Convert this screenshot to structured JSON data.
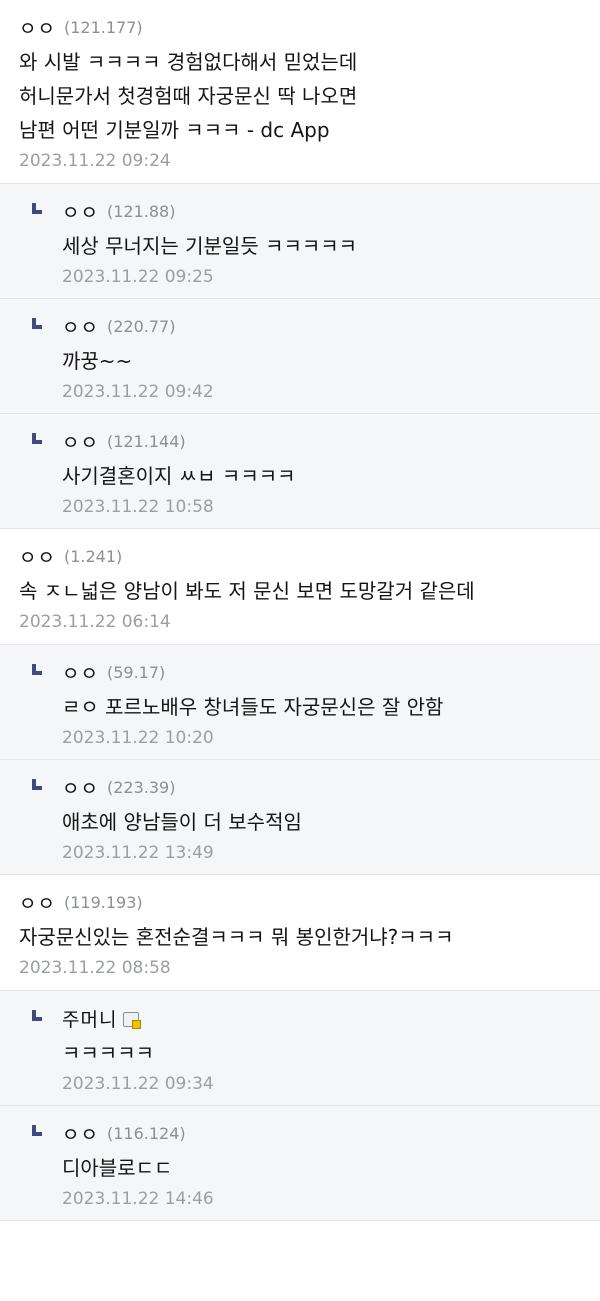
{
  "comments": [
    {
      "nick": "ㅇㅇ",
      "ip": "(121.177)",
      "lines": [
        "와 시발 ㅋㅋㅋㅋ 경험없다해서 믿었는데",
        "허니문가서 첫경험때 자궁문신 딱 나오면",
        "남편 어떤 기분일까 ㅋㅋㅋ - dc App"
      ],
      "date": "2023.11.22 09:24",
      "replies": [
        {
          "nick": "ㅇㅇ",
          "ip": "(121.88)",
          "text": "세상 무너지는 기분일듯 ㅋㅋㅋㅋㅋ",
          "date": "2023.11.22 09:25"
        },
        {
          "nick": "ㅇㅇ",
          "ip": "(220.77)",
          "text": "까꿍~~",
          "date": "2023.11.22 09:42"
        },
        {
          "nick": "ㅇㅇ",
          "ip": "(121.144)",
          "text": "사기결혼이지 ㅆㅂ ㅋㅋㅋㅋ",
          "date": "2023.11.22 10:58"
        }
      ]
    },
    {
      "nick": "ㅇㅇ",
      "ip": "(1.241)",
      "lines": [
        "속 ㅈㄴ넓은 양남이 봐도 저 문신 보면 도망갈거 같은데"
      ],
      "date": "2023.11.22 06:14",
      "replies": [
        {
          "nick": "ㅇㅇ",
          "ip": "(59.17)",
          "text": "ㄹㅇ 포르노배우 창녀들도 자궁문신은 잘 안함",
          "date": "2023.11.22 10:20"
        },
        {
          "nick": "ㅇㅇ",
          "ip": "(223.39)",
          "text": "애초에 양남들이 더 보수적임",
          "date": "2023.11.22 13:49"
        }
      ]
    },
    {
      "nick": "ㅇㅇ",
      "ip": "(119.193)",
      "lines": [
        "자궁문신있는 혼전순결ㅋㅋㅋ 뭐 봉인한거냐?ㅋㅋㅋ"
      ],
      "date": "2023.11.22 08:58",
      "replies": [
        {
          "nick": "주머니",
          "ip": "",
          "gallog": "gallog-icon",
          "text": "ㅋㅋㅋㅋㅋ",
          "date": "2023.11.22 09:34"
        },
        {
          "nick": "ㅇㅇ",
          "ip": "(116.124)",
          "text": "디아블로ㄷㄷ",
          "date": "2023.11.22 14:46"
        }
      ]
    }
  ]
}
